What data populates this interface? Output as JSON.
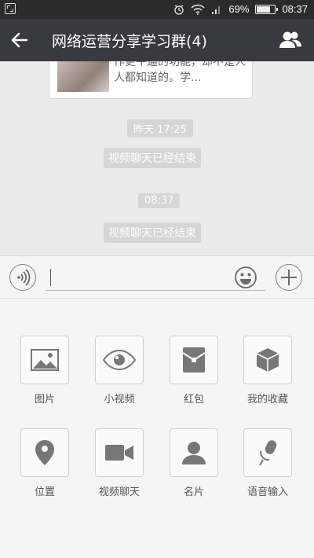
{
  "status": {
    "battery_pct": "69%",
    "battery_level": 0.69,
    "time": "08:37"
  },
  "header": {
    "title": "网络运营分享学习群(4)"
  },
  "chat": {
    "card_desc": "作更牛逼的功能，却不是人人都知道的。学...",
    "messages": [
      {
        "time": "昨天 17:25",
        "text": "视频聊天已经结束"
      },
      {
        "time": "08:37",
        "text": "视频聊天已经结束"
      }
    ]
  },
  "input": {
    "value": "",
    "placeholder": ""
  },
  "tools": [
    {
      "label": "图片",
      "icon": "image-icon"
    },
    {
      "label": "小视频",
      "icon": "eye-icon"
    },
    {
      "label": "红包",
      "icon": "red-envelope-icon"
    },
    {
      "label": "我的收藏",
      "icon": "cube-icon"
    },
    {
      "label": "位置",
      "icon": "location-pin-icon"
    },
    {
      "label": "视频聊天",
      "icon": "video-camera-icon"
    },
    {
      "label": "名片",
      "icon": "person-card-icon"
    },
    {
      "label": "语音输入",
      "icon": "microphone-icon"
    }
  ],
  "colors": {
    "header_bg": "#393a3f",
    "statusbar_bg": "#2b2b2b",
    "chat_bg": "#ebebeb",
    "pill_bg": "#d6d6d6",
    "icon_gray": "#7a7a7a"
  }
}
